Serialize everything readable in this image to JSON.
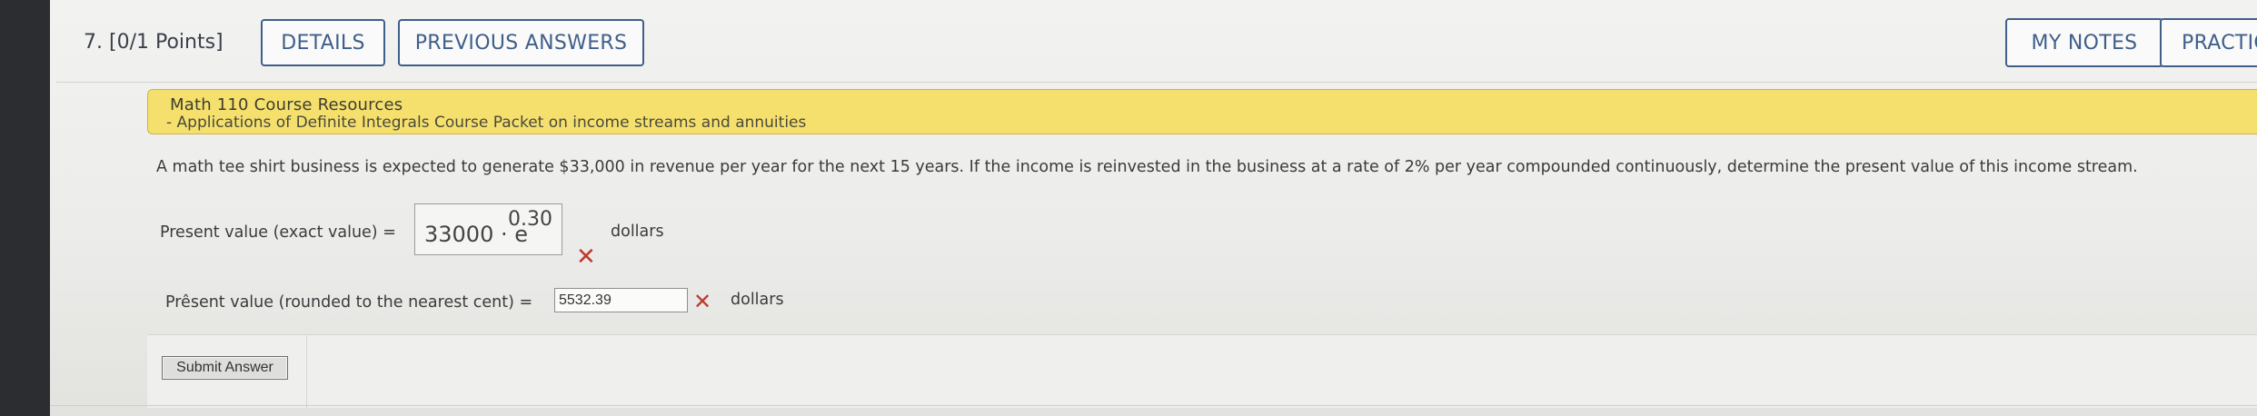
{
  "question": {
    "header": "7.  [0/1 Points]",
    "buttons": {
      "details": "DETAILS",
      "previous_answers": "PREVIOUS ANSWERS",
      "my_notes": "MY NOTES",
      "practice": "PRACTIC"
    }
  },
  "resources": {
    "title": "Math 110 Course Resources",
    "link": "- Applications of Definite Integrals Course Packet on income streams and annuities"
  },
  "problem_text": "A math tee shirt business is expected to generate $33,000 in revenue per year for the next 15 years. If the income is reinvested in the business at a rate of 2% per year compounded continuously, determine the present value of this income stream.",
  "answers": {
    "exact": {
      "label": "Present value (exact value) =",
      "base": "33000 · e",
      "exponent": "0.30",
      "unit": "dollars",
      "status_icon": "x-icon",
      "status_mark": "✕"
    },
    "rounded": {
      "label": "Prêsent value (rounded to the nearest cent) =",
      "value": "5532.39",
      "unit": "dollars",
      "status_icon": "x-icon",
      "status_mark": "✕"
    }
  },
  "submit_label": "Submit Answer",
  "colors": {
    "accent_blue": "#3f5f8a",
    "resource_yellow": "#f5e06e",
    "error_red": "#c0392b"
  }
}
